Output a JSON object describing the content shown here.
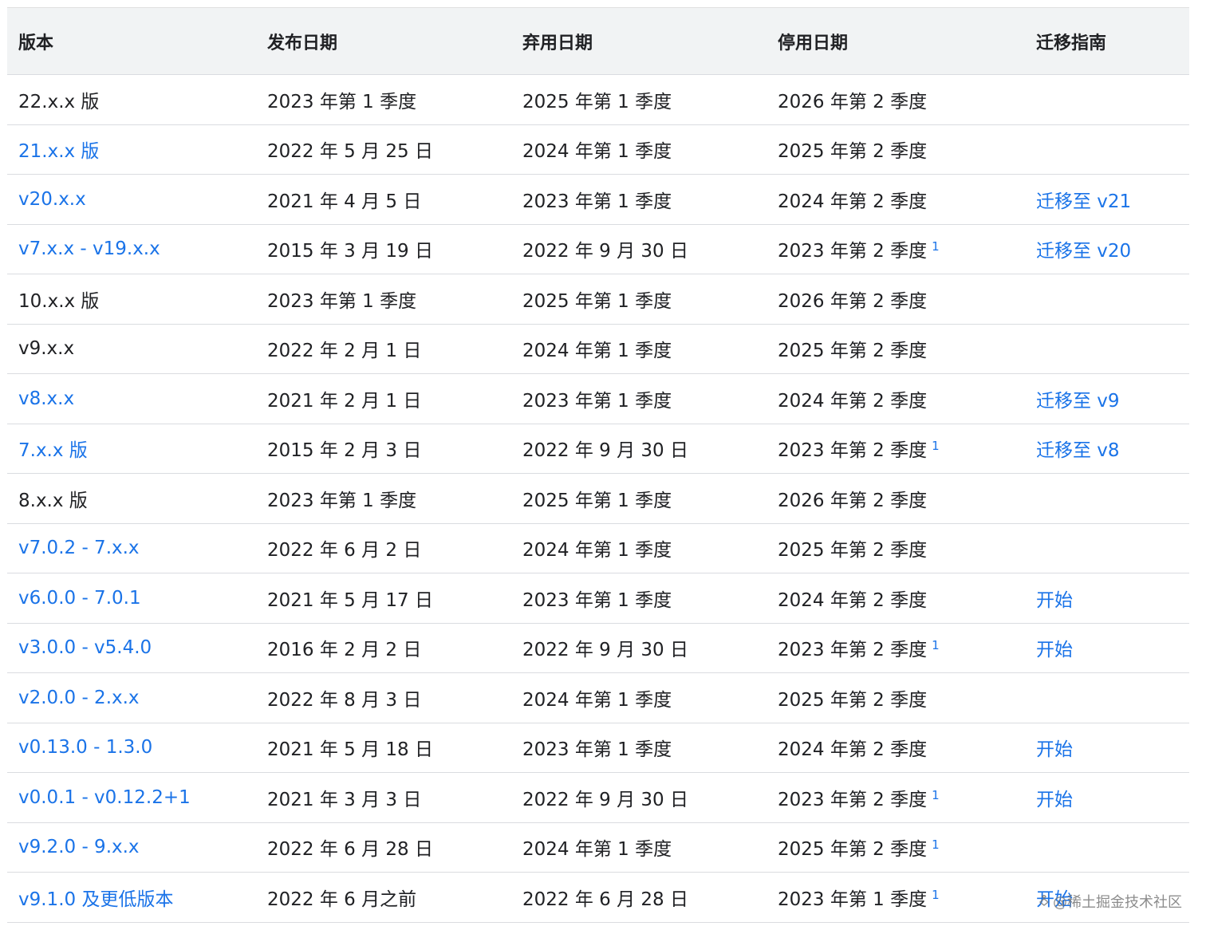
{
  "headers": [
    "版本",
    "发布日期",
    "弃用日期",
    "停用日期",
    "迁移指南"
  ],
  "rows": [
    {
      "version": "22.x.x 版",
      "version_link": false,
      "release": "2023 年第 1 季度",
      "deprecation": "2025 年第 1 季度",
      "sunset": "2026 年第 2 季度",
      "footnote": "",
      "guide": ""
    },
    {
      "version": "21.x.x 版",
      "version_link": true,
      "release": "2022 年 5 月 25 日",
      "deprecation": "2024 年第 1 季度",
      "sunset": "2025 年第 2 季度",
      "footnote": "",
      "guide": ""
    },
    {
      "version": "v20.x.x",
      "version_link": true,
      "release": "2021 年 4 月 5 日",
      "deprecation": "2023 年第 1 季度",
      "sunset": "2024 年第 2 季度",
      "footnote": "",
      "guide": "迁移至 v21"
    },
    {
      "version": "v7.x.x - v19.x.x",
      "version_link": true,
      "release": "2015 年 3 月 19 日",
      "deprecation": "2022 年 9 月 30 日",
      "sunset": "2023 年第 2 季度",
      "footnote": "1",
      "guide": "迁移至 v20"
    },
    {
      "version": "10.x.x 版",
      "version_link": false,
      "release": "2023 年第 1 季度",
      "deprecation": "2025 年第 1 季度",
      "sunset": "2026 年第 2 季度",
      "footnote": "",
      "guide": ""
    },
    {
      "version": "v9.x.x",
      "version_link": false,
      "release": "2022 年 2 月 1 日",
      "deprecation": "2024 年第 1 季度",
      "sunset": "2025 年第 2 季度",
      "footnote": "",
      "guide": ""
    },
    {
      "version": "v8.x.x",
      "version_link": true,
      "release": "2021 年 2 月 1 日",
      "deprecation": "2023 年第 1 季度",
      "sunset": "2024 年第 2 季度",
      "footnote": "",
      "guide": "迁移至 v9"
    },
    {
      "version": "7.x.x 版",
      "version_link": true,
      "release": "2015 年 2 月 3 日",
      "deprecation": "2022 年 9 月 30 日",
      "sunset": "2023 年第 2 季度",
      "footnote": "1",
      "guide": "迁移至 v8"
    },
    {
      "version": "8.x.x 版",
      "version_link": false,
      "release": "2023 年第 1 季度",
      "deprecation": "2025 年第 1 季度",
      "sunset": "2026 年第 2 季度",
      "footnote": "",
      "guide": ""
    },
    {
      "version": "v7.0.2 - 7.x.x",
      "version_link": true,
      "release": "2022 年 6 月 2 日",
      "deprecation": "2024 年第 1 季度",
      "sunset": "2025 年第 2 季度",
      "footnote": "",
      "guide": ""
    },
    {
      "version": "v6.0.0 - 7.0.1",
      "version_link": true,
      "release": "2021 年 5 月 17 日",
      "deprecation": "2023 年第 1 季度",
      "sunset": "2024 年第 2 季度",
      "footnote": "",
      "guide": "开始"
    },
    {
      "version": "v3.0.0 - v5.4.0",
      "version_link": true,
      "release": "2016 年 2 月 2 日",
      "deprecation": "2022 年 9 月 30 日",
      "sunset": "2023 年第 2 季度",
      "footnote": "1",
      "guide": "开始"
    },
    {
      "version": "v2.0.0 - 2.x.x",
      "version_link": true,
      "release": "2022 年 8 月 3 日",
      "deprecation": "2024 年第 1 季度",
      "sunset": "2025 年第 2 季度",
      "footnote": "",
      "guide": ""
    },
    {
      "version": "v0.13.0 - 1.3.0",
      "version_link": true,
      "release": "2021 年 5 月 18 日",
      "deprecation": "2023 年第 1 季度",
      "sunset": "2024 年第 2 季度",
      "footnote": "",
      "guide": "开始"
    },
    {
      "version": "v0.0.1 - v0.12.2+1",
      "version_link": true,
      "release": "2021 年 3 月 3 日",
      "deprecation": "2022 年 9 月 30 日",
      "sunset": "2023 年第 2 季度",
      "footnote": "1",
      "guide": "开始"
    },
    {
      "version": "v9.2.0 - 9.x.x",
      "version_link": true,
      "release": "2022 年 6 月 28 日",
      "deprecation": "2024 年第 1 季度",
      "sunset": "2025 年第 2 季度",
      "footnote": "1",
      "guide": ""
    },
    {
      "version": "v9.1.0 及更低版本",
      "version_link": true,
      "release": "2022 年 6 月之前",
      "deprecation": "2022 年 6 月 28 日",
      "sunset": "2023 年第 1 季度",
      "footnote": "1",
      "guide": "开始"
    }
  ],
  "watermark": "@稀土掘金技术社区",
  "colors": {
    "link": "#1a73e8",
    "header_bg": "#f1f3f4",
    "border": "#dadce0",
    "text": "#202124"
  }
}
